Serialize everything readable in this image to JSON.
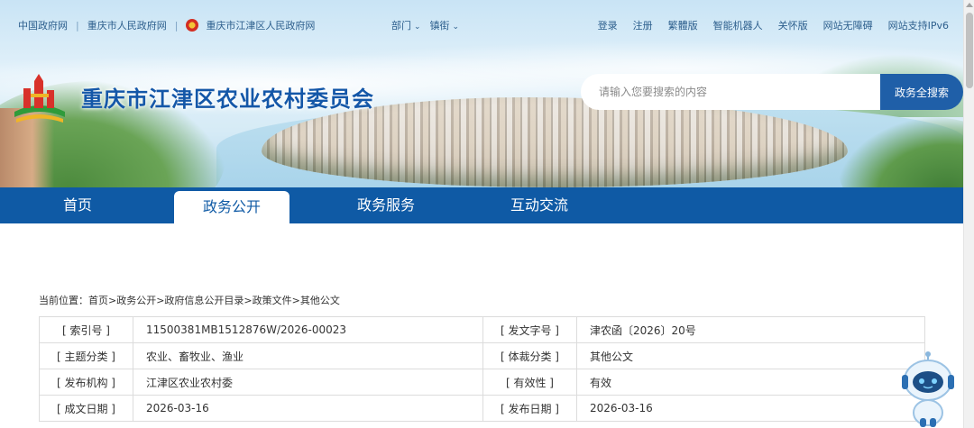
{
  "top_links": {
    "gov_china": "中国政府网",
    "gov_chongqing": "重庆市人民政府网",
    "gov_jiangjin": "重庆市江津区人民政府网"
  },
  "dept_menu": {
    "departments": "部门",
    "towns": "镇街"
  },
  "right_links": [
    "登录",
    "注册",
    "繁體版",
    "智能机器人",
    "关怀版",
    "网站无障碍",
    "网站支持IPv6"
  ],
  "site_title": "重庆市江津区农业农村委员会",
  "search": {
    "placeholder": "请输入您要搜索的内容",
    "button": "政务全搜索"
  },
  "nav": [
    "首页",
    "政务公开",
    "政务服务",
    "互动交流"
  ],
  "nav_active": "政务公开",
  "breadcrumb": {
    "prefix": "当前位置：",
    "path": "首页>政务公开>政府信息公开目录>政策文件>其他公文"
  },
  "info": {
    "index_no": {
      "label": "[ 索引号 ]",
      "value": "11500381MB1512876W/2026-00023"
    },
    "doc_no": {
      "label": "[ 发文字号 ]",
      "value": "津农函〔2026〕20号"
    },
    "topic": {
      "label": "[ 主题分类 ]",
      "value": "农业、畜牧业、渔业"
    },
    "genre": {
      "label": "[ 体裁分类 ]",
      "value": "其他公文"
    },
    "issuer": {
      "label": "[ 发布机构 ]",
      "value": "江津区农业农村委"
    },
    "validity": {
      "label": "[ 有效性 ]",
      "value": "有效"
    },
    "created": {
      "label": "[ 成文日期 ]",
      "value": "2026-03-16"
    },
    "published": {
      "label": "[ 发布日期 ]",
      "value": "2026-03-16"
    }
  },
  "colors": {
    "brand_blue": "#0f5aa5",
    "title_blue": "#1457a8",
    "link_blue": "#2d5f8d"
  }
}
